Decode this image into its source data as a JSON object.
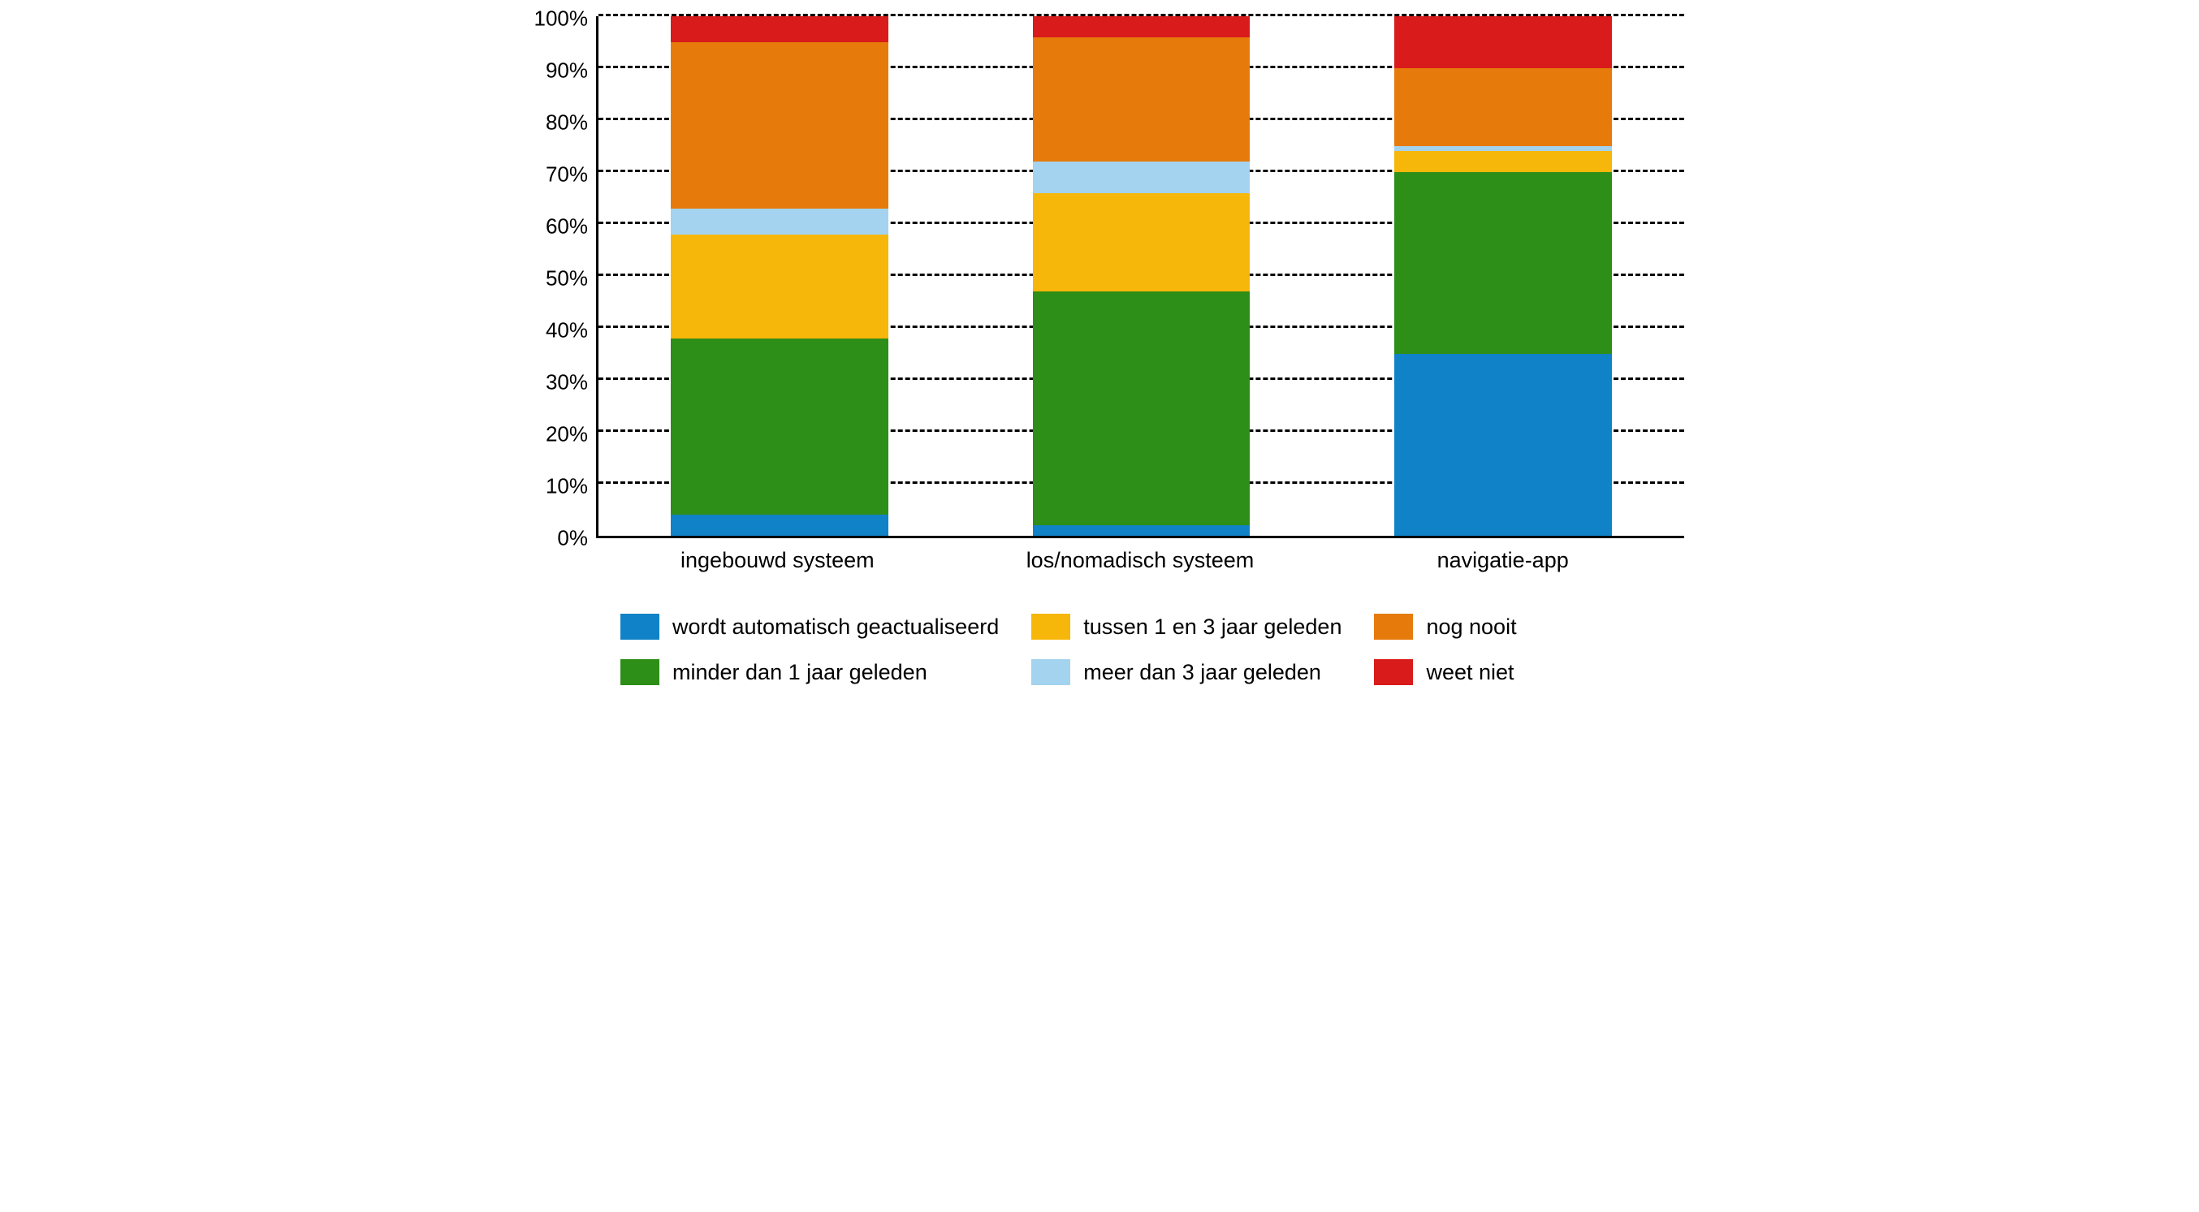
{
  "chart_data": {
    "type": "bar",
    "stacked": true,
    "ylabel_unit": "%",
    "ylim": [
      0,
      100
    ],
    "y_ticks": [
      0,
      10,
      20,
      30,
      40,
      50,
      60,
      70,
      80,
      90,
      100
    ],
    "y_tick_labels": [
      "0%",
      "10%",
      "20%",
      "30%",
      "40%",
      "50%",
      "60%",
      "70%",
      "80%",
      "90%",
      "100%"
    ],
    "categories": [
      "ingebouwd systeem",
      "los/nomadisch systeem",
      "navigatie-app"
    ],
    "series_order": [
      "wordt automatisch geactualiseerd",
      "minder dan 1 jaar geleden",
      "tussen 1 en 3 jaar geleden",
      "meer dan 3 jaar geleden",
      "nog nooit",
      "weet niet"
    ],
    "colors": {
      "wordt automatisch geactualiseerd": "#1082c8",
      "minder dan 1 jaar geleden": "#2d8e18",
      "tussen 1 en 3 jaar geleden": "#f7b60a",
      "meer dan 3 jaar geleden": "#a3d3ee",
      "nog nooit": "#e67b0c",
      "weet niet": "#d91b1b"
    },
    "series": [
      {
        "name": "wordt automatisch geactualiseerd",
        "values": [
          4,
          2,
          35
        ]
      },
      {
        "name": "minder dan 1 jaar geleden",
        "values": [
          34,
          45,
          35
        ]
      },
      {
        "name": "tussen 1 en 3 jaar geleden",
        "values": [
          20,
          19,
          4
        ]
      },
      {
        "name": "meer dan 3 jaar geleden",
        "values": [
          5,
          6,
          1
        ]
      },
      {
        "name": "nog nooit",
        "values": [
          32,
          24,
          15
        ]
      },
      {
        "name": "weet niet",
        "values": [
          5,
          4,
          10
        ]
      }
    ],
    "legend_layout": [
      [
        "wordt automatisch geactualiseerd",
        "tussen 1 en 3 jaar geleden",
        "nog nooit"
      ],
      [
        "minder dan 1 jaar geleden",
        "meer dan 3 jaar geleden",
        "weet niet"
      ]
    ]
  }
}
